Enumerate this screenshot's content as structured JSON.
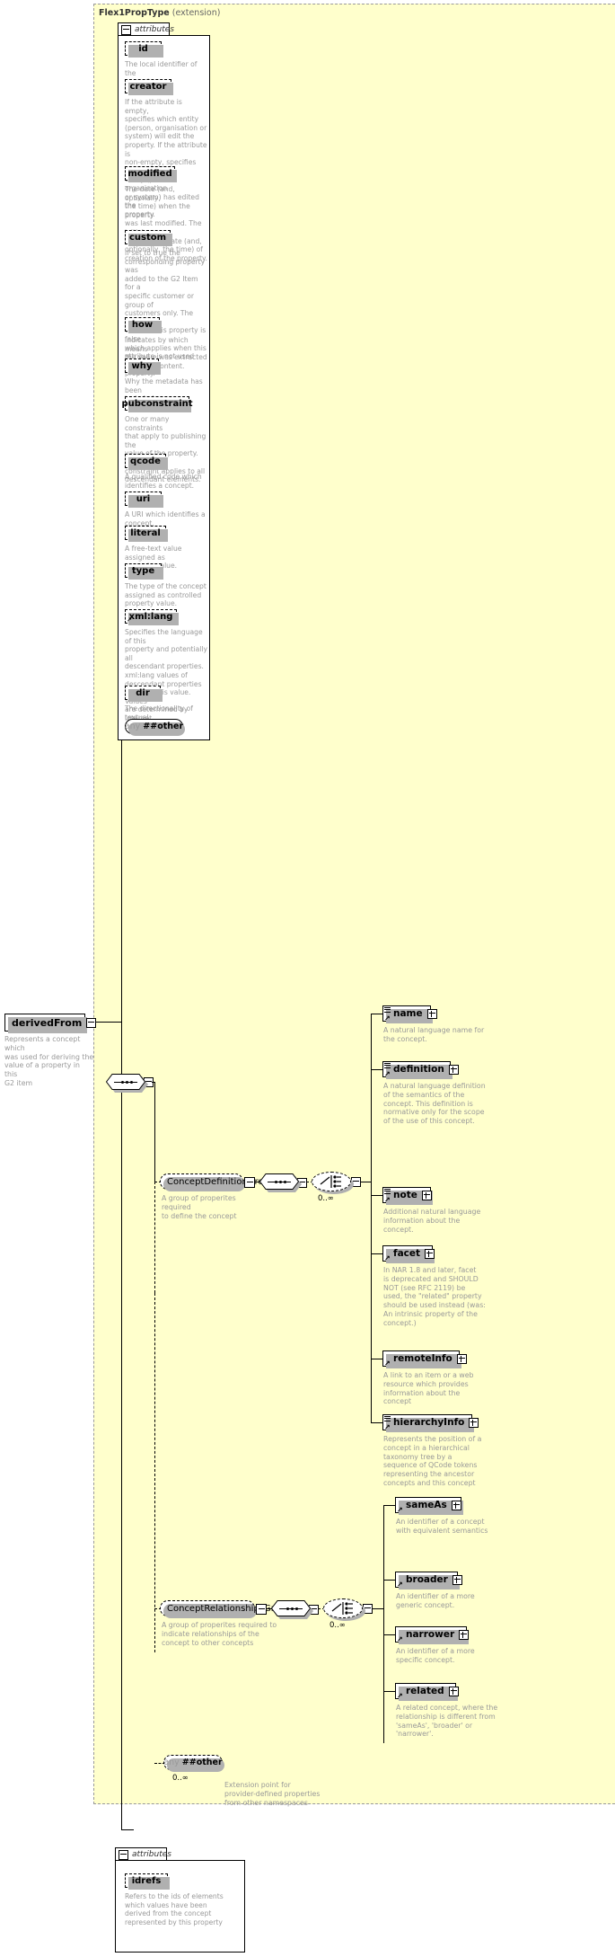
{
  "diagram": {
    "type": "xml-schema-element-diagram",
    "root": {
      "name": "derivedFrom",
      "description": "Represents a concept which\nwas used for deriving the\nvalue of a property in this\nG2 item"
    },
    "extension": {
      "type_name": "Flex1PropType",
      "suffix": "(extension)"
    },
    "attributes_label": "attributes",
    "attributes": [
      {
        "name": "id",
        "description": "The local identifier of the\nproperty."
      },
      {
        "name": "creator",
        "description": "If the attribute is empty,\nspecifies which entity\n(person, organisation or\nsystem) will edit the\nproperty. If the attribute is\nnon-empty, specifies which\nentity (person, organisation\nor system) has edited the\nproperty."
      },
      {
        "name": "modified",
        "description": "The date (and, optionally,\nthe time) when the property\nwas last modified. The initial\nvalue is the date (and,\noptionally, the time) of\ncreation of the property."
      },
      {
        "name": "custom",
        "description": "If set to true the\ncorresponding property was\nadded to the G2 Item for a\nspecific customer or group of\ncustomers only. The default\nvalue of this property is false\nwhich applies when this\nattribute is not used with the\nproperty."
      },
      {
        "name": "how",
        "description": "Indicates by which means\nthe value was extracted\nfrom the content."
      },
      {
        "name": "why",
        "description": "Why the metadata has been\nincluded."
      },
      {
        "name": "pubconstraint",
        "description": "One or many constraints\nthat apply to publishing the\nvalue of the property. Each\nconstraint applies to all\ndescendant elements."
      },
      {
        "name": "qcode",
        "description": "A qualified code which\nidentifies a concept."
      },
      {
        "name": "uri",
        "description": "A URI which identifies a\nconcept."
      },
      {
        "name": "literal",
        "description": "A free-text value assigned as\nproperty value."
      },
      {
        "name": "type",
        "description": "The type of the concept\nassigned as controlled\nproperty value."
      },
      {
        "name": "xmllang",
        "label": "xml:lang",
        "description": "Specifies the language of this\nproperty and potentially all\ndescendant properties.\nxml:lang values of\ndescendant properties\noverride this value. Values\nare determined by Internet\nBCP 47."
      },
      {
        "name": "dir",
        "description": "The directionality of textual\ncontent."
      }
    ],
    "any_attribute": {
      "prefix": "any",
      "label": "##other"
    },
    "groups": [
      {
        "name": "ConceptDefinitionGroup",
        "description": "A group of properites required\nto define the concept",
        "occurs": "0..∞",
        "elements": [
          {
            "name": "name",
            "description": "A natural language name for\nthe concept."
          },
          {
            "name": "definition",
            "description": "A natural language definition\nof the semantics of the\nconcept. This definition is\nnormative only for the scope\nof the use of this concept."
          },
          {
            "name": "note",
            "description": "Additional natural language\ninformation about the\nconcept."
          },
          {
            "name": "facet",
            "description": "In NAR 1.8 and later, facet\nis deprecated and SHOULD\nNOT (see RFC 2119) be\nused, the \"related\" property\nshould be used instead (was:\nAn intrinsic property of the\nconcept.)"
          },
          {
            "name": "remoteInfo",
            "description": "A link to an item or a web\nresource which provides\ninformation about the\nconcept"
          },
          {
            "name": "hierarchyInfo",
            "description": "Represents the position of a\nconcept in a hierarchical\ntaxonomy tree by a\nsequence of QCode tokens\nrepresenting the ancestor\nconcepts and this concept"
          }
        ]
      },
      {
        "name": "ConceptRelationshipsGroup",
        "description": "A group of properites required to\nindicate relationships of the\nconcept to other concepts",
        "occurs": "0..∞",
        "elements": [
          {
            "name": "sameAs",
            "description": "An identifier of a concept\nwith equivalent semantics"
          },
          {
            "name": "broader",
            "description": "An identifier of a more\ngeneric concept."
          },
          {
            "name": "narrower",
            "description": "An identifier of a more\nspecific concept."
          },
          {
            "name": "related",
            "description": "A related concept, where the\nrelationship is different from\n'sameAs', 'broader' or\n'narrower'."
          }
        ]
      }
    ],
    "any_element": {
      "prefix": "any",
      "label": "##other",
      "occurs": "0..∞",
      "description": "Extension point for\nprovider-defined properties\nfrom other namespaces"
    },
    "bottom_attributes": {
      "label": "attributes",
      "items": [
        {
          "name": "idrefs",
          "description": "Refers to the ids of elements\nwhich values have been\nderived from the concept\nrepresented by this property"
        }
      ]
    },
    "colors": {
      "extension_bg": "#ffffcc",
      "description_text": "#999999",
      "line": "#000000",
      "shadow": "#b0b0b0"
    }
  }
}
